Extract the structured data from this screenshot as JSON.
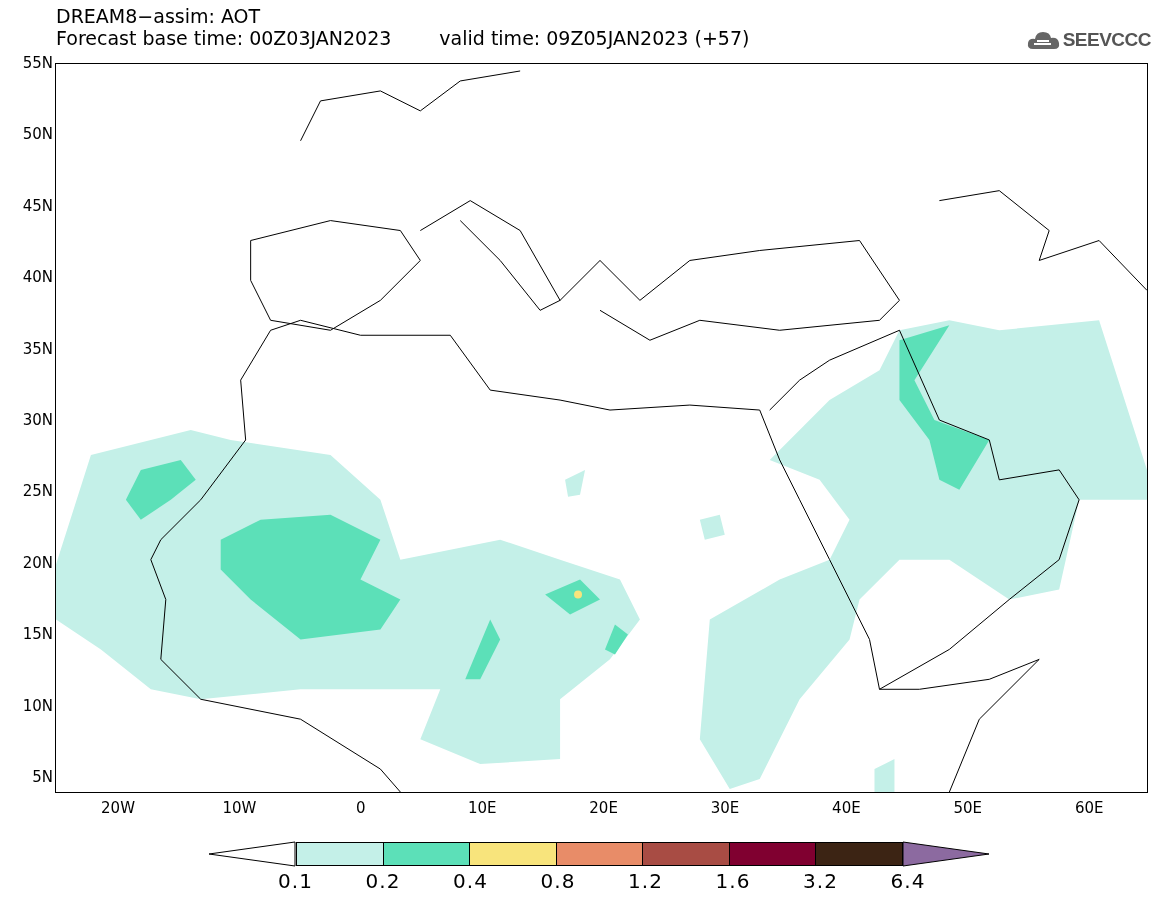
{
  "header": {
    "title": "DREAM8−assim: AOT",
    "base_time": "Forecast base time: 00Z03JAN2023",
    "valid_time": "valid time: 09Z05JAN2023 (+57)",
    "logo_text": "SEEVCCC"
  },
  "map": {
    "lat_labels": [
      "55N",
      "50N",
      "45N",
      "40N",
      "35N",
      "30N",
      "25N",
      "20N",
      "15N",
      "10N",
      "5N"
    ],
    "lon_labels": [
      "20W",
      "10W",
      "0",
      "10E",
      "20E",
      "30E",
      "40E",
      "50E",
      "60E"
    ]
  },
  "legend": {
    "swatches": [
      {
        "kind": "below",
        "color": "#ffffff"
      },
      {
        "kind": "bin",
        "color": "#c4f0e8"
      },
      {
        "kind": "bin",
        "color": "#5ce0b8"
      },
      {
        "kind": "bin",
        "color": "#f8e47c"
      },
      {
        "kind": "bin",
        "color": "#e88c68"
      },
      {
        "kind": "bin",
        "color": "#a84c44"
      },
      {
        "kind": "bin",
        "color": "#800030"
      },
      {
        "kind": "bin",
        "color": "#3c2414"
      },
      {
        "kind": "above",
        "color": "#8c6aa0"
      }
    ],
    "labels": [
      "0.1",
      "0.2",
      "0.4",
      "0.8",
      "1.2",
      "1.6",
      "3.2",
      "6.4"
    ]
  }
}
